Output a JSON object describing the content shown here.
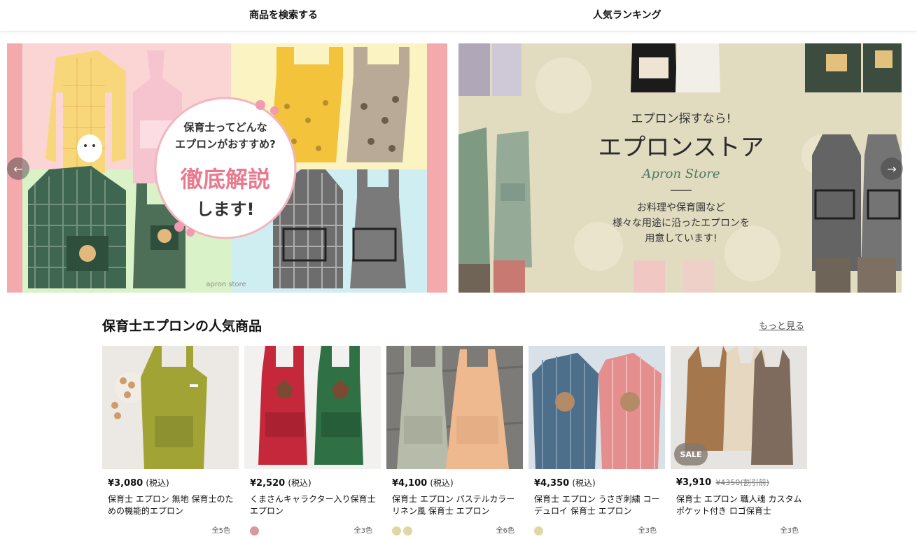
{
  "nav": {
    "search_label": "商品を検索する",
    "ranking_label": "人気ランキング"
  },
  "carousel": {
    "banner1": {
      "line1": "保育士ってどんな",
      "line2": "エプロンがおすすめ?",
      "headline": "徹底解説",
      "tail": "します!",
      "watermark": "apron store"
    },
    "banner2": {
      "eyebrow": "エプロン探すなら!",
      "title": "エプロンストア",
      "script": "Apron Store",
      "desc1": "お料理や保育園など",
      "desc2": "様々な用途に沿ったエプロンを",
      "desc3": "用意しています!"
    },
    "prev_icon": "arrow-left-icon",
    "next_icon": "arrow-right-icon"
  },
  "section": {
    "title": "保育士エプロンの人気商品",
    "more_label": "もっと見る"
  },
  "products": [
    {
      "price": "¥3,080",
      "tax": "(税込)",
      "name": "保育士 エプロン 無地 保育士のための機能的エプロン",
      "swatches": [],
      "colors_label": "全5色"
    },
    {
      "price": "¥2,520",
      "tax": "(税込)",
      "name": "くまさんキャラクター入り保育士 エプロン",
      "swatches": [
        "#d89aa2"
      ],
      "colors_label": "全3色"
    },
    {
      "price": "¥4,100",
      "tax": "(税込)",
      "name": "保育士 エプロン パステルカラー リネン風 保育士 エプロン",
      "swatches": [
        "#e2d6a4",
        "#e2d6a4"
      ],
      "colors_label": "全6色"
    },
    {
      "price": "¥4,350",
      "tax": "(税込)",
      "name": "保育士 エプロン うさぎ刺繍 コーデュロイ 保育士 エプロン",
      "swatches": [
        "#e2d6a4"
      ],
      "colors_label": "全3色"
    },
    {
      "price": "¥3,910",
      "original_price": "¥4350",
      "original_tax": "(割引前)",
      "badge": "SALE",
      "name": "保育士 エプロン 職人魂 カスタム ポケット付き ロゴ保育士",
      "swatches": [],
      "colors_label": "全3色"
    }
  ]
}
